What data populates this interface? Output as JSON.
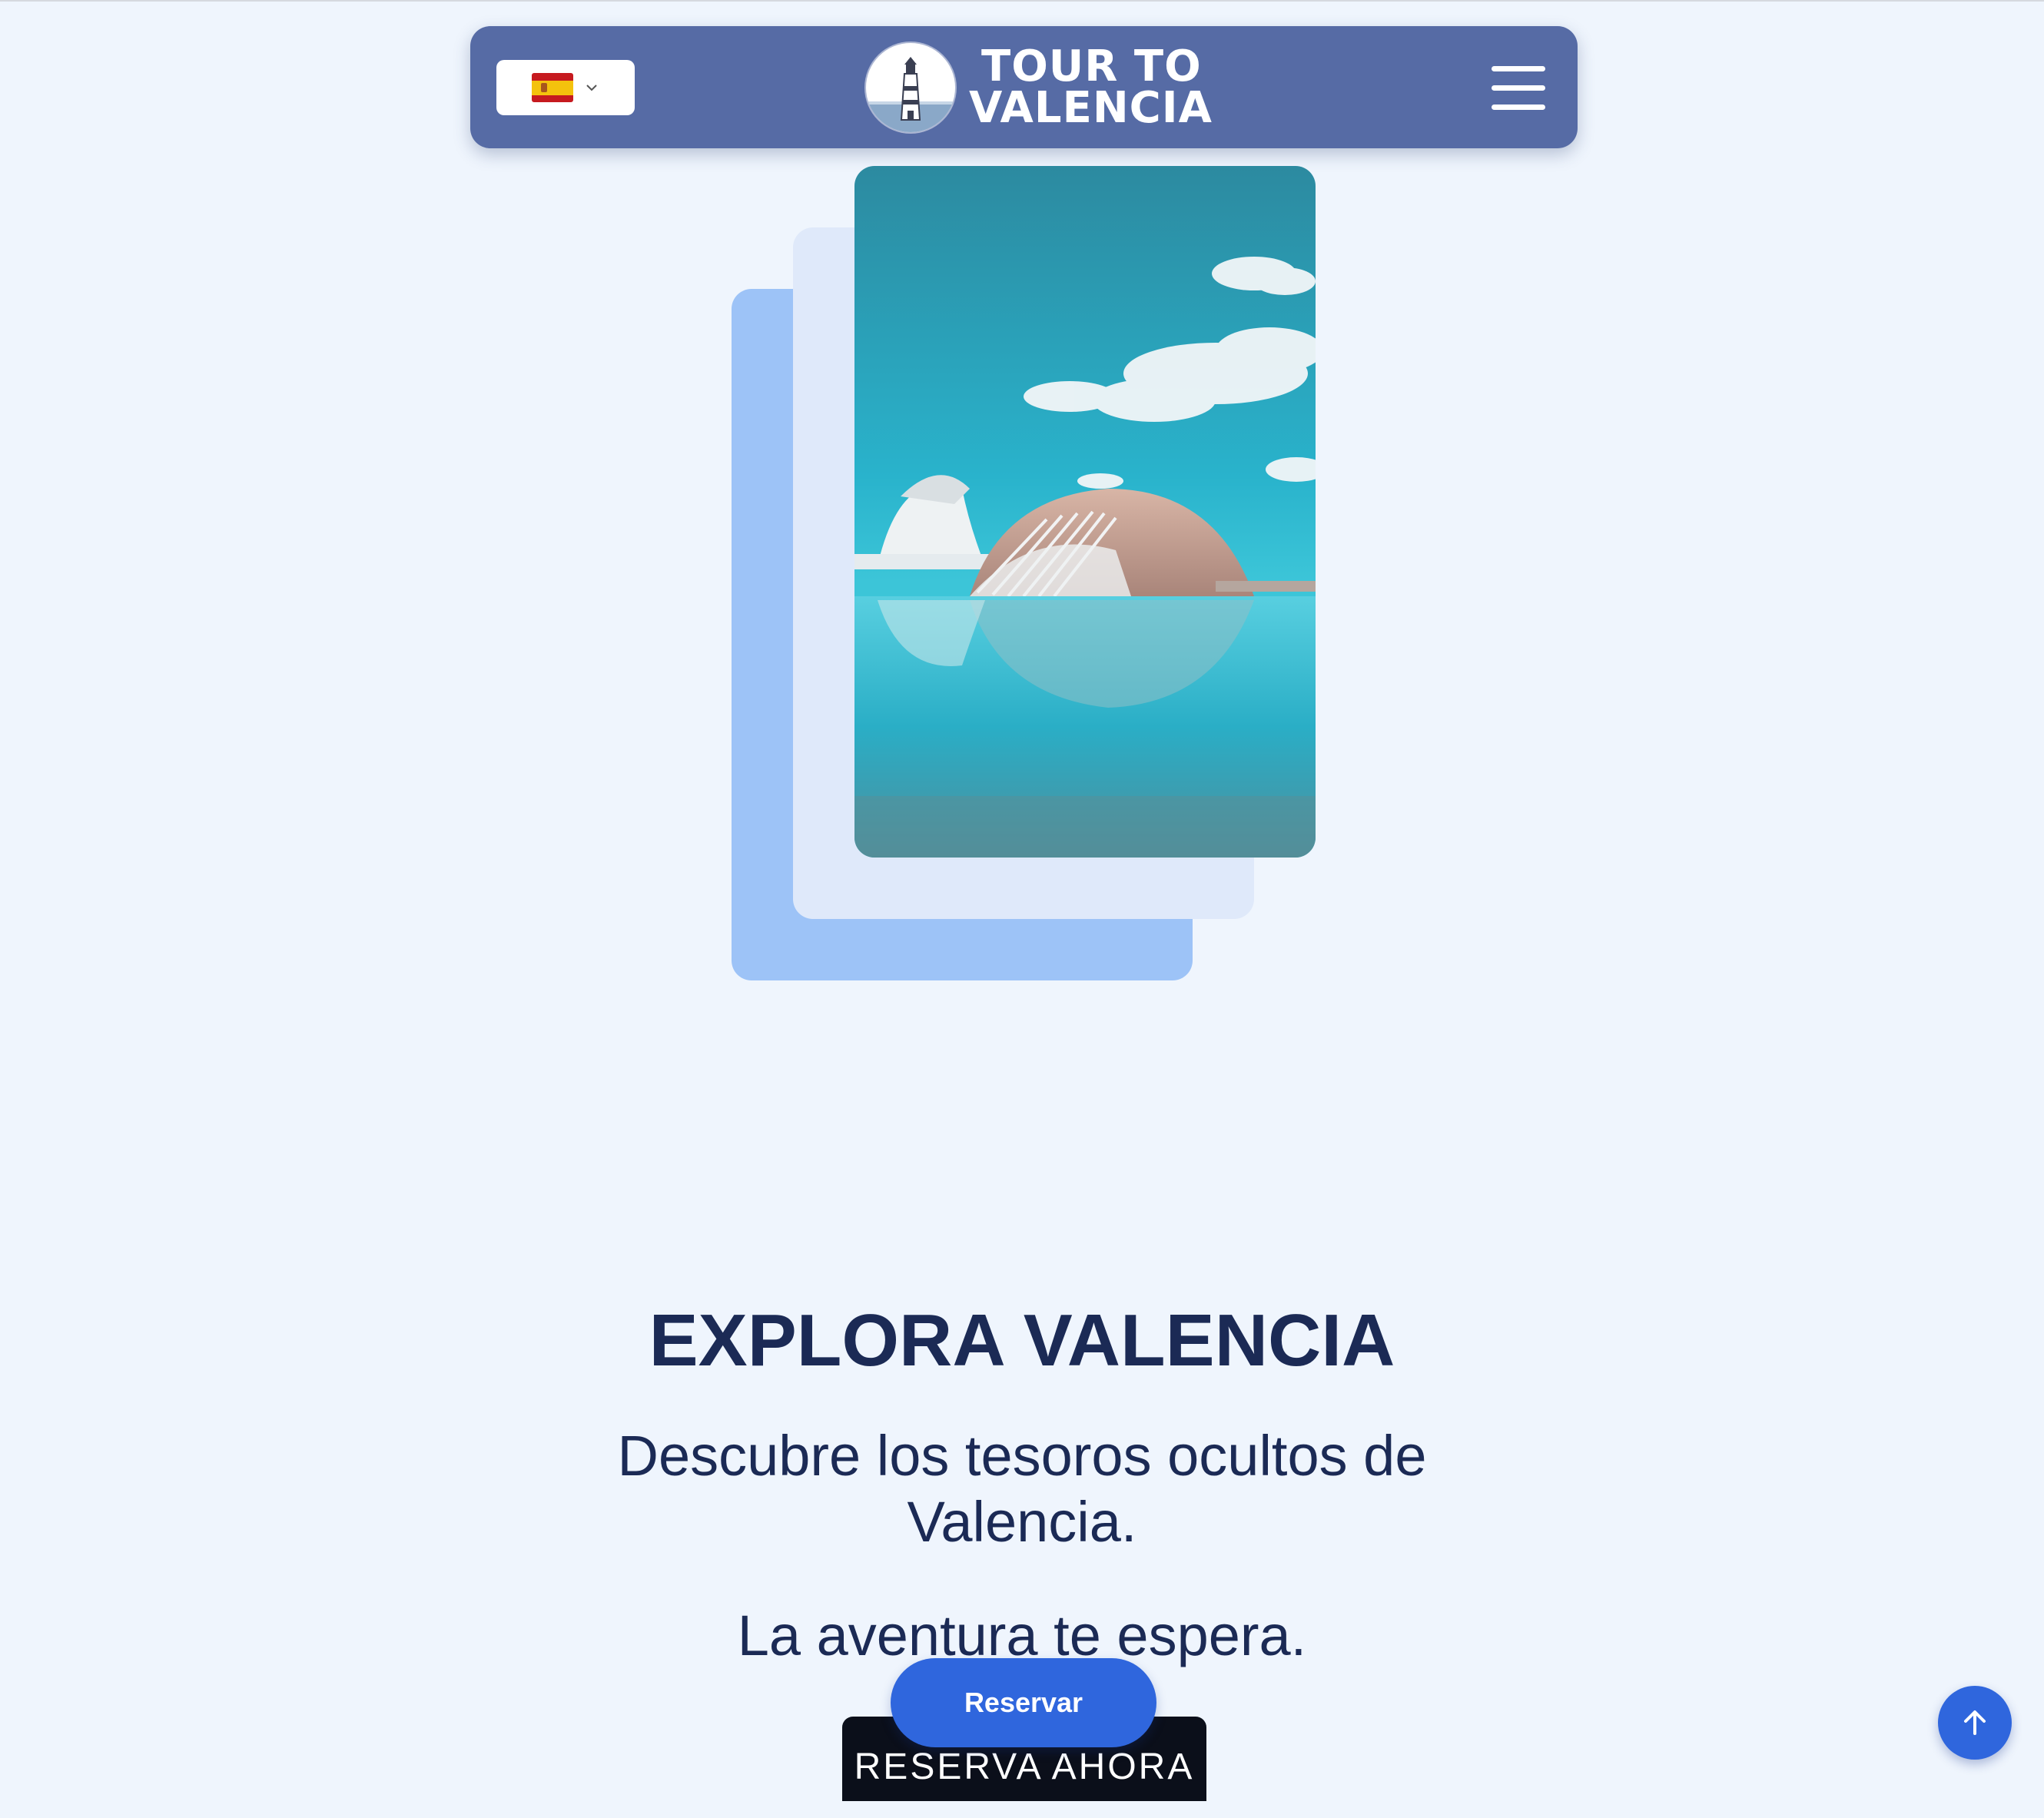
{
  "header": {
    "language": {
      "flag_icon": "spain-flag-icon",
      "chevron_icon": "chevron-down-icon"
    },
    "brand": {
      "line1": "TOUR TO",
      "line2": "VALENCIA",
      "logo_icon": "lighthouse-logo-icon"
    },
    "menu_icon": "hamburger-menu-icon"
  },
  "hero": {
    "image": "city-of-arts-and-sciences-photo",
    "title": "EXPLORA VALENCIA",
    "subtitle": "Descubre los tesoros ocultos de Valencia.",
    "tagline": "La aventura te espera."
  },
  "actions": {
    "reserve_label": "Reservar",
    "book_now_label": "RESERVA AHORA",
    "scroll_top_icon": "arrow-up-icon"
  },
  "colors": {
    "navbar": "#566ba5",
    "page_background": "#eff5fd",
    "primary_button": "#2f66dd",
    "title_text": "#1b2a55",
    "card_back": "#9dc3f7",
    "card_mid": "#dfe9fa"
  }
}
